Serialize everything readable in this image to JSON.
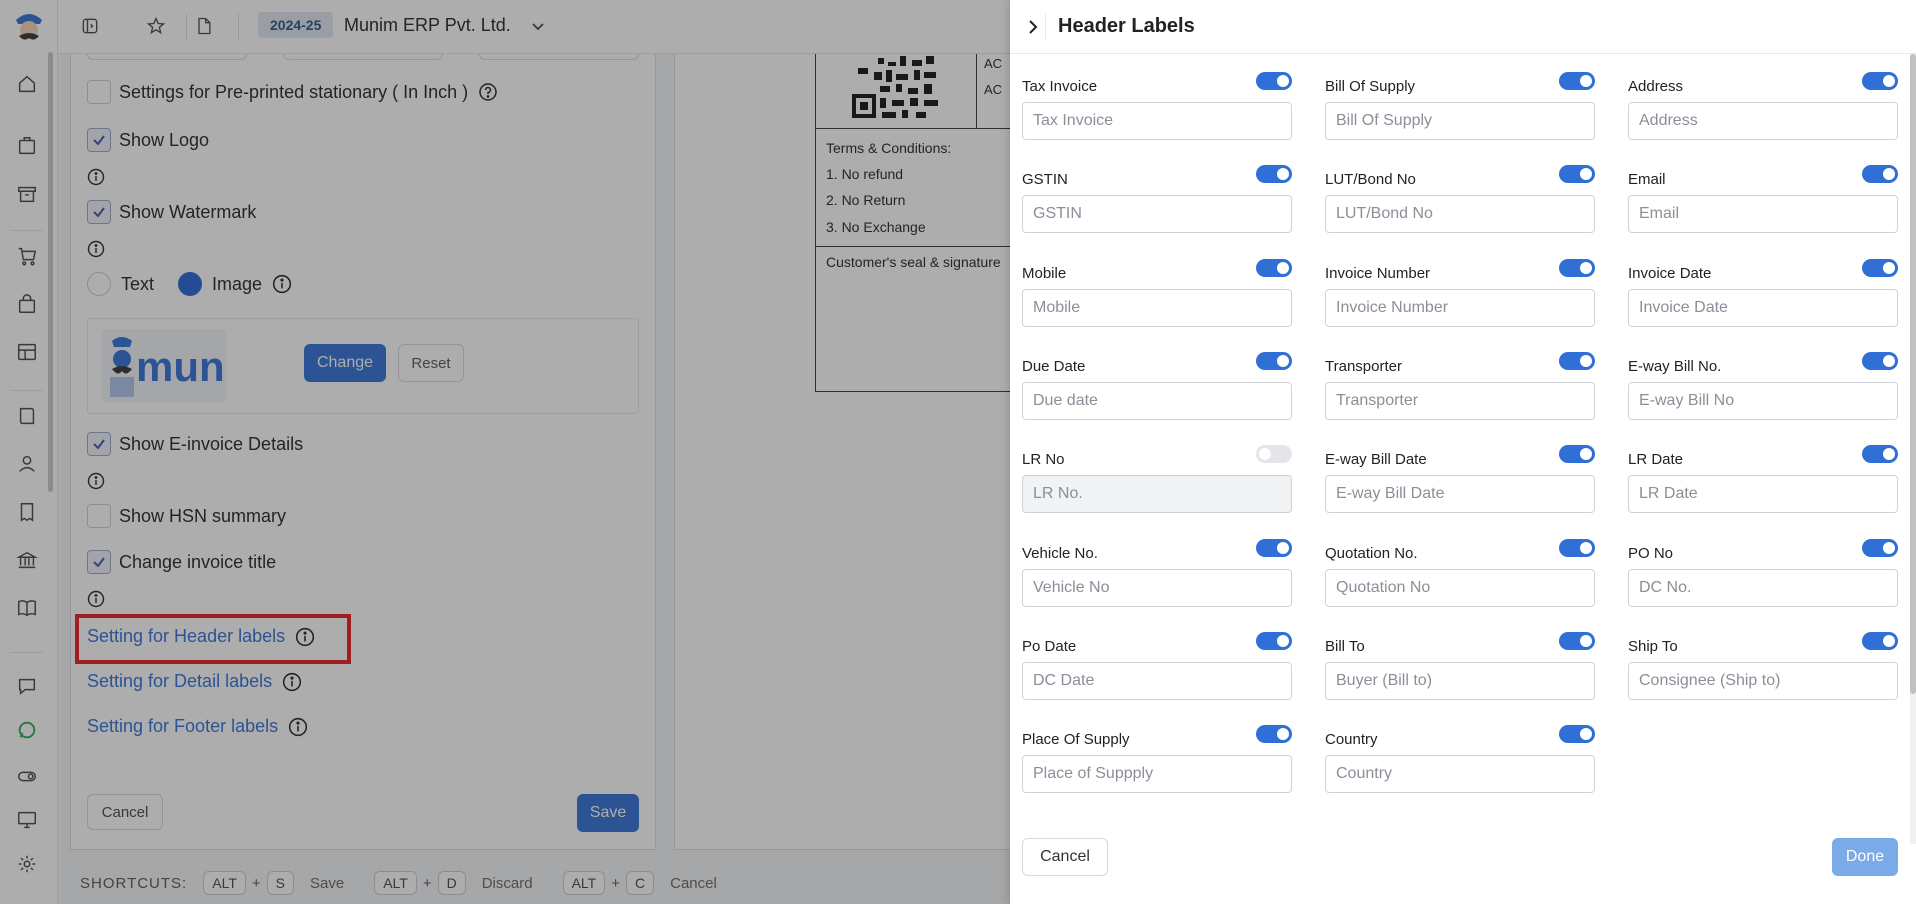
{
  "topbar": {
    "year": "2024-25",
    "company": "Munim ERP Pvt. Ltd."
  },
  "settings": {
    "preprinted_label": "Settings for Pre-printed stationary ( In Inch )",
    "show_logo": "Show Logo",
    "show_watermark": "Show Watermark",
    "watermark_text": "Text",
    "watermark_image": "Image",
    "logo_text": "muni",
    "change_btn": "Change",
    "reset_btn": "Reset",
    "show_einvoice": "Show E-invoice Details",
    "show_hsn": "Show HSN summary",
    "change_title": "Change invoice title",
    "header_link": "Setting for Header labels",
    "detail_link": "Setting for Detail labels",
    "footer_link": "Setting for Footer labels",
    "cancel_btn": "Cancel",
    "save_btn": "Save"
  },
  "preview": {
    "ac1": "AC",
    "ac2": "AC",
    "terms_title": "Terms & Conditions:",
    "terms": [
      "1. No refund",
      "2. No Return",
      "3. No Exchange"
    ],
    "seal": "Customer's seal & signature"
  },
  "shortcuts": {
    "title": "SHORTCUTS:",
    "items": [
      {
        "k1": "ALT",
        "plus": "+",
        "k2": "S",
        "label": "Save"
      },
      {
        "k1": "ALT",
        "plus": "+",
        "k2": "D",
        "label": "Discard"
      },
      {
        "k1": "ALT",
        "plus": "+",
        "k2": "C",
        "label": "Cancel"
      }
    ]
  },
  "drawer": {
    "title": "Header Labels",
    "cancel": "Cancel",
    "done": "Done",
    "fields": [
      {
        "label": "Tax Invoice",
        "placeholder": "Tax Invoice",
        "on": true
      },
      {
        "label": "Bill Of Supply",
        "placeholder": "Bill Of Supply",
        "on": true
      },
      {
        "label": "Address",
        "placeholder": "Address",
        "on": true
      },
      {
        "label": "GSTIN",
        "placeholder": "GSTIN",
        "on": true
      },
      {
        "label": "LUT/Bond No",
        "placeholder": "LUT/Bond No",
        "on": true
      },
      {
        "label": "Email",
        "placeholder": "Email",
        "on": true
      },
      {
        "label": "Mobile",
        "placeholder": "Mobile",
        "on": true
      },
      {
        "label": "Invoice Number",
        "placeholder": "Invoice Number",
        "on": true
      },
      {
        "label": "Invoice Date",
        "placeholder": "Invoice Date",
        "on": true
      },
      {
        "label": "Due Date",
        "placeholder": "Due date",
        "on": true
      },
      {
        "label": "Transporter",
        "placeholder": "Transporter",
        "on": true
      },
      {
        "label": "E-way Bill No.",
        "placeholder": "E-way Bill No",
        "on": true
      },
      {
        "label": "LR No",
        "placeholder": "LR No.",
        "on": false
      },
      {
        "label": "E-way Bill Date",
        "placeholder": "E-way Bill Date",
        "on": true
      },
      {
        "label": "LR Date",
        "placeholder": "LR Date",
        "on": true
      },
      {
        "label": "Vehicle No.",
        "placeholder": "Vehicle No",
        "on": true
      },
      {
        "label": "Quotation No.",
        "placeholder": "Quotation No",
        "on": true
      },
      {
        "label": "PO No",
        "placeholder": "DC No.",
        "on": true
      },
      {
        "label": "Po Date",
        "placeholder": "DC Date",
        "on": true
      },
      {
        "label": "Bill To",
        "placeholder": "Buyer (Bill to)",
        "on": true
      },
      {
        "label": "Ship To",
        "placeholder": "Consignee (Ship to)",
        "on": true
      },
      {
        "label": "Place Of Supply",
        "placeholder": "Place of Suppply",
        "on": true
      },
      {
        "label": "Country",
        "placeholder": "Country",
        "on": true
      }
    ]
  }
}
